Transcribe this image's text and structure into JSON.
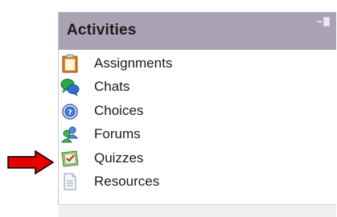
{
  "block": {
    "title": "Activities",
    "items": [
      {
        "label": "Assignments",
        "icon": "assignment-icon"
      },
      {
        "label": "Chats",
        "icon": "chat-icon"
      },
      {
        "label": "Choices",
        "icon": "choice-icon"
      },
      {
        "label": "Forums",
        "icon": "forum-icon"
      },
      {
        "label": "Quizzes",
        "icon": "quiz-icon"
      },
      {
        "label": "Resources",
        "icon": "resource-icon"
      }
    ]
  },
  "annotation": {
    "pointer": "arrow-right-icon",
    "color": "#e60000"
  },
  "colors": {
    "header_bg": "#a9a3b4",
    "body_bg": "#ffffff"
  }
}
